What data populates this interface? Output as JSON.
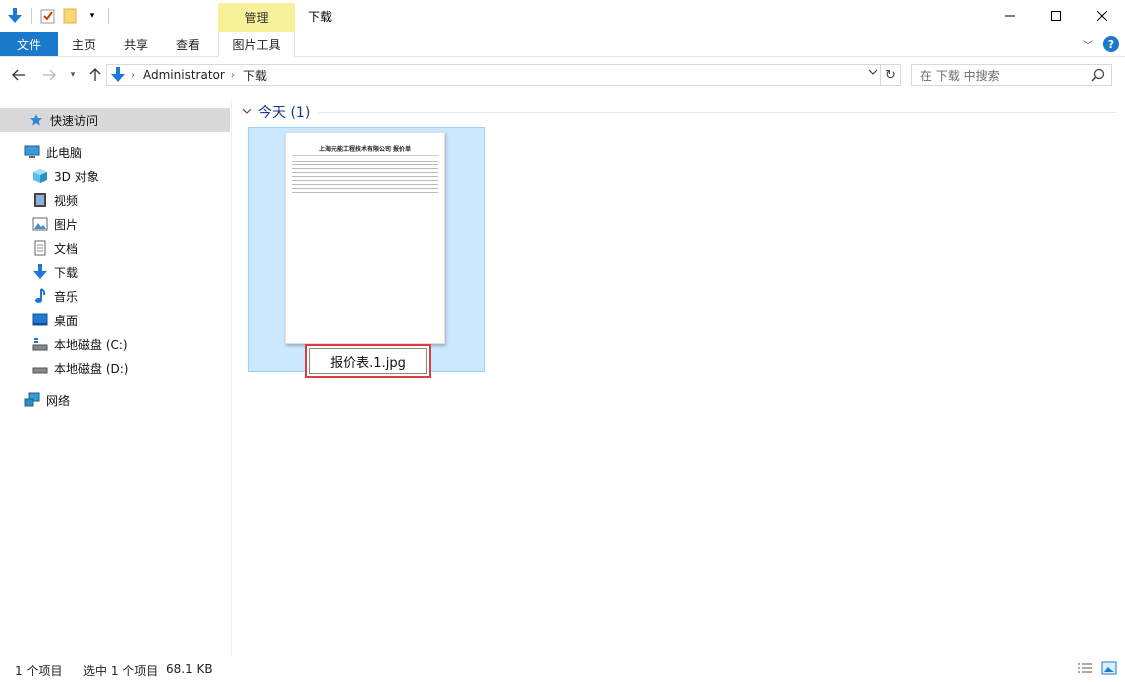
{
  "window": {
    "title": "下载",
    "manage_tab": "管理",
    "minimize": "—",
    "maximize": "☐",
    "close": "✕"
  },
  "ribbon": {
    "tabs": [
      "文件",
      "主页",
      "共享",
      "查看",
      "图片工具"
    ]
  },
  "address": {
    "crumbs": [
      "Administrator",
      "下载"
    ]
  },
  "search": {
    "placeholder": "在 下载 中搜索"
  },
  "sidebar": {
    "items": [
      {
        "label": "快速访问",
        "icon": "star-icon"
      },
      {
        "label": "此电脑",
        "icon": "computer-icon"
      },
      {
        "label": "3D 对象",
        "icon": "cube-icon"
      },
      {
        "label": "视频",
        "icon": "video-icon"
      },
      {
        "label": "图片",
        "icon": "picture-icon"
      },
      {
        "label": "文档",
        "icon": "document-icon"
      },
      {
        "label": "下载",
        "icon": "download-icon"
      },
      {
        "label": "音乐",
        "icon": "music-icon"
      },
      {
        "label": "桌面",
        "icon": "desktop-icon"
      },
      {
        "label": "本地磁盘 (C:)",
        "icon": "drive-icon"
      },
      {
        "label": "本地磁盘 (D:)",
        "icon": "drive-icon"
      },
      {
        "label": "网络",
        "icon": "network-icon"
      }
    ]
  },
  "content": {
    "group_header": "今天 (1)",
    "file": {
      "name_editing": "报价表.1.jpg",
      "thumb_title": "上海元能工程技术有限公司 报价单"
    }
  },
  "status": {
    "count": "1 个项目",
    "selected": "选中 1 个项目",
    "size": "68.1 KB"
  },
  "colors": {
    "accent": "#1979ca",
    "selection_fill": "#cce8ff",
    "selection_border": "#99d1ff",
    "rename_highlight": "#e03a3a",
    "manage_tab": "#f7f19a"
  }
}
